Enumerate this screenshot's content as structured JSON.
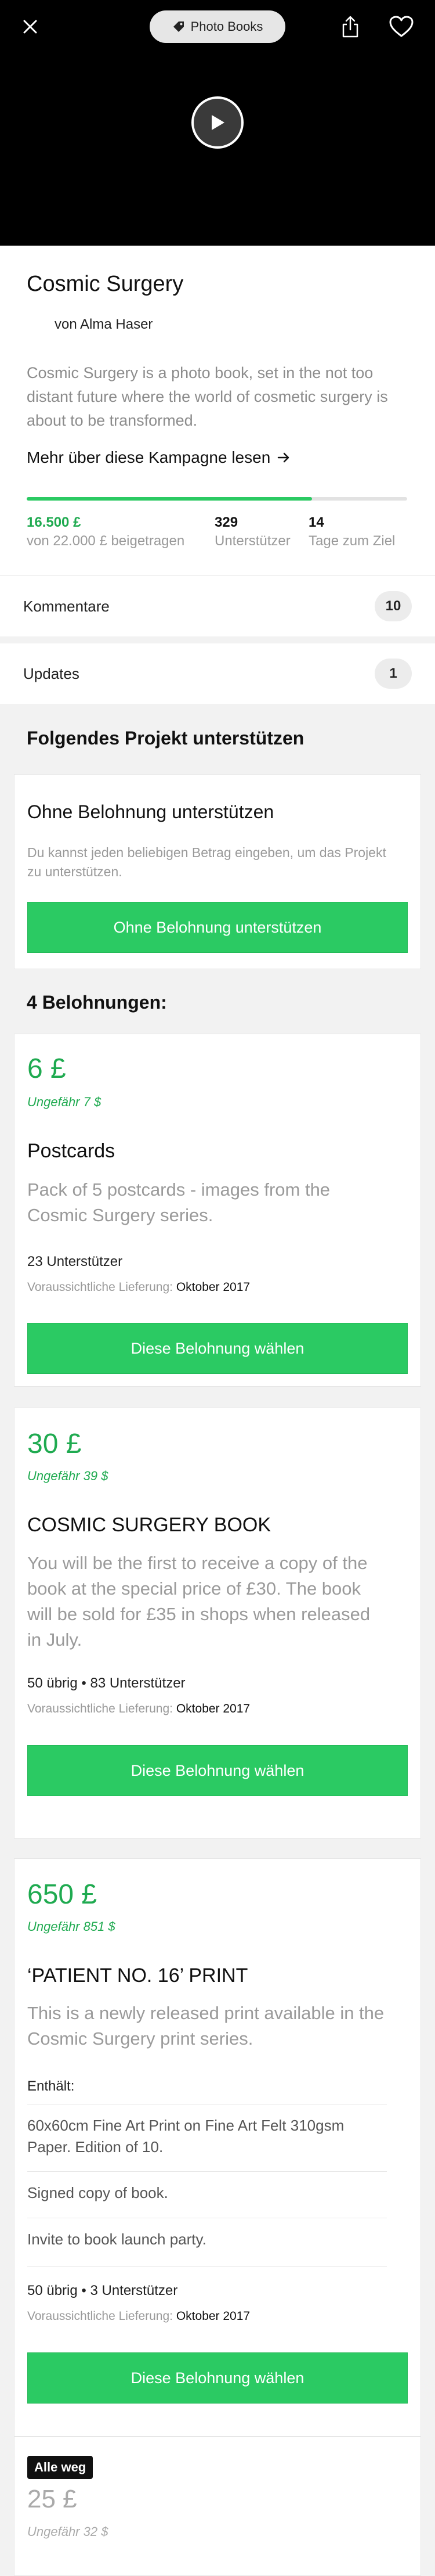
{
  "header": {
    "category": "Photo Books",
    "close_icon": "close-icon",
    "share_icon": "share-icon",
    "heart_icon": "heart-icon",
    "play_icon": "play-icon"
  },
  "project": {
    "title": "Cosmic Surgery",
    "author": "von Alma Haser",
    "description": "Cosmic Surgery is a photo book, set in the not too distant future where the world of cosmetic surgery is about to be transformed.",
    "more_link": "Mehr über diese Kampagne lesen",
    "progress_fraction": 0.75,
    "stats": [
      {
        "value": "16.500 £",
        "label": "von 22.000 £ beigetragen"
      },
      {
        "value": "329",
        "label": "Unterstützer"
      },
      {
        "value": "14",
        "label": "Tage zum Ziel"
      }
    ]
  },
  "rows": {
    "comments": {
      "label": "Kommentare",
      "count": "10"
    },
    "updates": {
      "label": "Updates",
      "count": "1"
    }
  },
  "support": {
    "heading": "Folgendes Projekt unterstützen",
    "no_reward": {
      "title": "Ohne Belohnung unterstützen",
      "text": "Du kannst jeden beliebigen Betrag eingeben, um das Projekt zu unterstützen.",
      "button": "Ohne Belohnung unterstützen"
    }
  },
  "rewards_heading": "4 Belohnungen:",
  "rewards": [
    {
      "price": "6 £",
      "approx": "Ungefähr 7 $",
      "title": "Postcards",
      "description": "Pack of 5 postcards - images from the Cosmic Surgery series.",
      "meta": "23 Unterstützer",
      "delivery_label": "Voraussichtliche Lieferung:",
      "delivery_value": "Oktober 2017",
      "button": "Diese Belohnung wählen"
    },
    {
      "price": "30 £",
      "approx": "Ungefähr 39 $",
      "title": "COSMIC SURGERY BOOK",
      "description": "You will be the first to receive a copy of the book at the special price of £30. The book will be sold for £35 in shops when released in July.",
      "meta": "50 übrig • 83 Unterstützer",
      "delivery_label": "Voraussichtliche Lieferung:",
      "delivery_value": "Oktober 2017",
      "button": "Diese Belohnung wählen"
    },
    {
      "price": "650 £",
      "approx": "Ungefähr 851 $",
      "title": "‘PATIENT NO. 16’ PRINT",
      "description": "This is a newly released print available in the Cosmic Surgery print series.",
      "includes_label": "Enthält:",
      "includes": [
        "60x60cm Fine Art Print on Fine Art Felt 310gsm Paper. Edition of 10.",
        "Signed copy of book.",
        "Invite to book launch party."
      ],
      "meta": "50 übrig • 3 Unterstützer",
      "delivery_label": "Voraussichtliche Lieferung:",
      "delivery_value": "Oktober 2017",
      "button": "Diese Belohnung wählen"
    },
    {
      "badge": "Alle weg",
      "price": "25 £",
      "approx": "Ungefähr 32 $"
    }
  ]
}
